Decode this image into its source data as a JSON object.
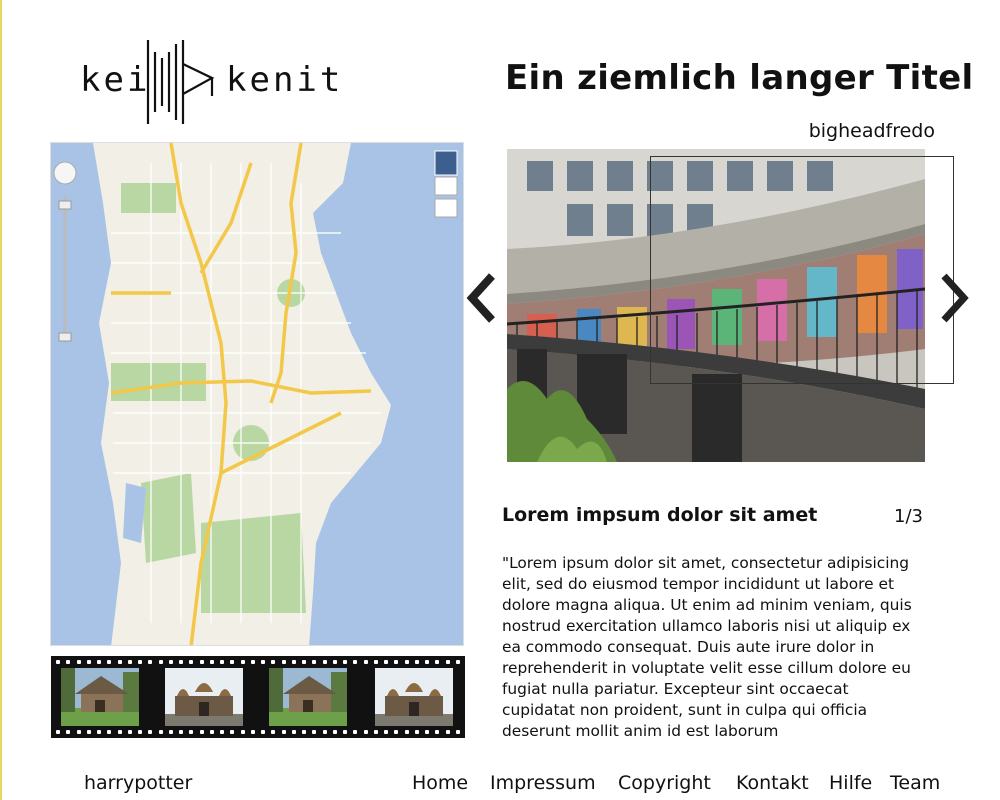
{
  "logo": {
    "left_text": "kei",
    "right_text": "kenit"
  },
  "title": "Ein ziemlich langer Titel",
  "author": "bigheadfredo",
  "carousel": {
    "prev_icon": "chevron-left-icon",
    "next_icon": "chevron-right-icon"
  },
  "caption": {
    "title": "Lorem impsum dolor sit amet",
    "counter": "1/3",
    "description": "\"Lorem ipsum dolor sit amet, consectetur adipisicing elit, sed do eiusmod tempor incididunt ut labore et dolore magna aliqua.  Ut enim ad minim veniam, quis nostrud exercitation ullamco laboris nisi ut aliquip ex ea commodo consequat.  Duis aute irure dolor in reprehenderit in voluptate velit esse cillum dolore eu fugiat nulla pariatur.  Excepteur sint occaecat cupidatat non proident, sunt in culpa qui officia deserunt mollit anim id est laborum"
  },
  "footer": {
    "user": "harrypotter",
    "nav": [
      "Home",
      "Impressum",
      "Copyright",
      "Kontakt",
      "Hilfe",
      "Team"
    ]
  },
  "colors": {
    "accent_edge": "#e8d85a",
    "map_water": "#a9c3e6",
    "map_land": "#f1efe6",
    "map_roads": "#f3c747",
    "map_parks": "#b9d7a2"
  }
}
